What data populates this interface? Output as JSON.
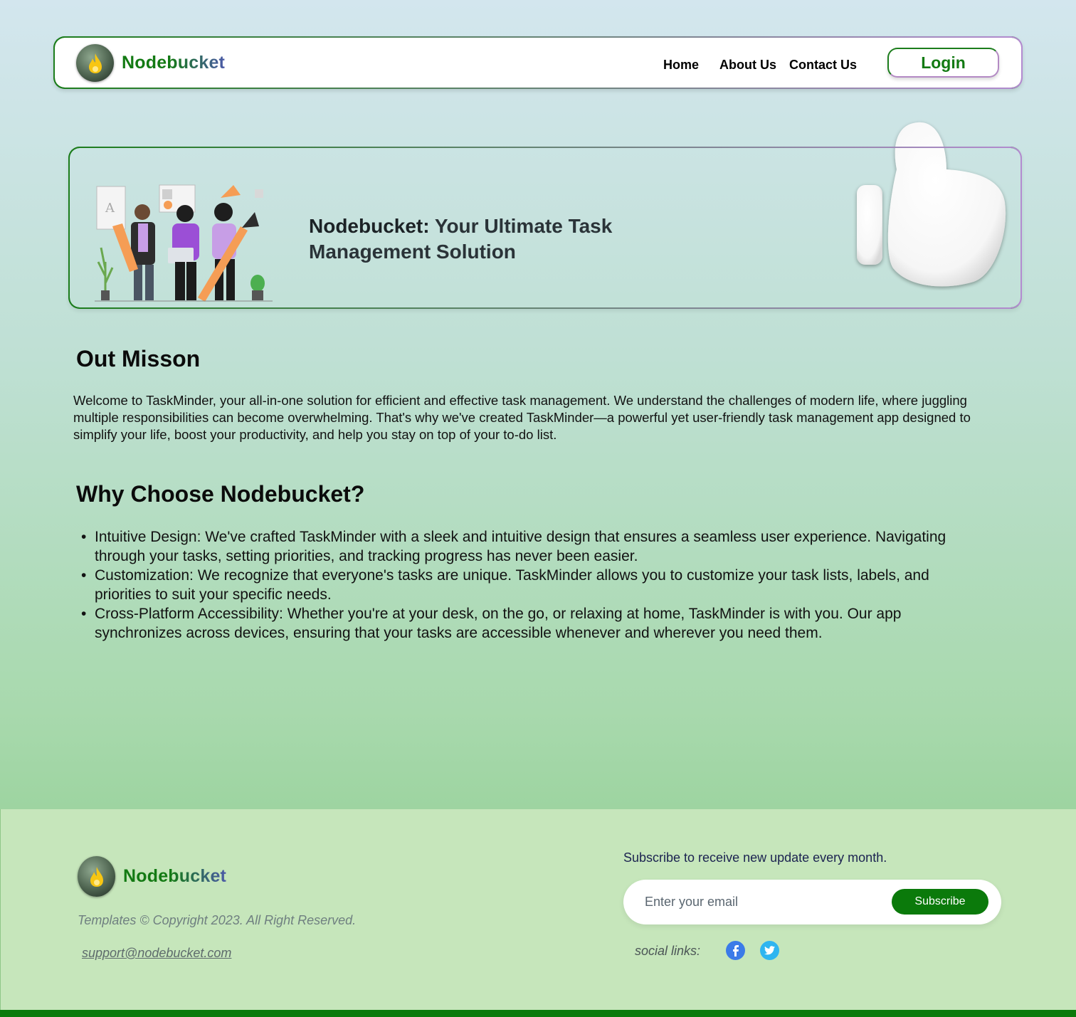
{
  "brand": {
    "name": "Nodebucket"
  },
  "nav": {
    "home": "Home",
    "about": "About Us",
    "contact": "Contact Us",
    "login": "Login"
  },
  "hero": {
    "title_bold": "Nodebucket:",
    "title_rest": " Your Ultimate Task Management Solution"
  },
  "mission": {
    "heading": "Out Misson",
    "text": "Welcome to TaskMinder, your all-in-one solution for efficient and effective task management. We understand the challenges of modern life, where juggling multiple responsibilities can become overwhelming. That's why we've created TaskMinder—a powerful yet user-friendly task management app designed to simplify your life, boost your productivity, and help you stay on top of your to-do list."
  },
  "why": {
    "heading_prefix": "Why Choose ",
    "heading_brand": "Nodebucket?",
    "items": [
      "Intuitive Design: We've crafted TaskMinder with a sleek and intuitive design that ensures a seamless user experience. Navigating through your tasks, setting priorities, and tracking progress has never been easier.",
      "Customization: We recognize that everyone's tasks are unique. TaskMinder allows you to customize your task lists, labels, and priorities to suit your specific needs.",
      "Cross-Platform Accessibility: Whether you're at your desk, on the go, or relaxing at home, TaskMinder is with you. Our app synchronizes across devices, ensuring that your tasks are accessible whenever and wherever you need them."
    ]
  },
  "footer": {
    "copyright": "Templates © Copyright 2023. All Right Reserved.",
    "support_email": "support@nodebucket.com",
    "subscribe_label": "Subscribe to receive new update every month.",
    "email_placeholder": "Enter your email",
    "subscribe_button": "Subscribe",
    "social_label": "social links:",
    "social": [
      {
        "icon": "facebook-icon",
        "color": "#3b7be8",
        "glyph": "f"
      },
      {
        "icon": "twitter-icon",
        "color": "#2fb5f0",
        "glyph": "t"
      }
    ]
  },
  "colors": {
    "brand_green": "#137a13",
    "accent_purple": "#b48ac4",
    "footer_bg": "#c6e6bb",
    "footer_bar": "#0b7a0b"
  }
}
